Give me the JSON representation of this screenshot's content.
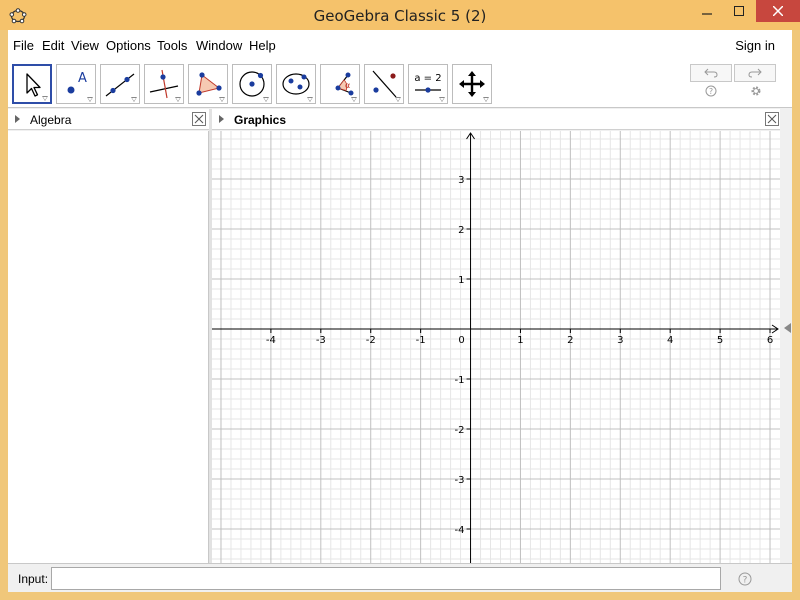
{
  "window": {
    "title": "GeoGebra Classic 5 (2)"
  },
  "menu": {
    "items": [
      "File",
      "Edit",
      "View",
      "Options",
      "Tools",
      "Window",
      "Help"
    ],
    "sign_in": "Sign in"
  },
  "toolbar": {
    "tools": [
      {
        "name": "move-tool",
        "icon": "arrow-pointer-icon"
      },
      {
        "name": "point-tool",
        "icon": "point-A-icon"
      },
      {
        "name": "line-tool",
        "icon": "line-through-points-icon"
      },
      {
        "name": "perpendicular-line-tool",
        "icon": "perpendicular-line-icon"
      },
      {
        "name": "polygon-tool",
        "icon": "polygon-icon"
      },
      {
        "name": "circle-tool",
        "icon": "circle-center-point-icon"
      },
      {
        "name": "ellipse-tool",
        "icon": "ellipse-icon"
      },
      {
        "name": "angle-tool",
        "icon": "angle-icon"
      },
      {
        "name": "reflect-tool",
        "icon": "reflect-about-line-icon"
      },
      {
        "name": "slider-tool",
        "icon": "slider-icon",
        "label": "a = 2"
      },
      {
        "name": "move-graphics-tool",
        "icon": "move-graphics-view-icon"
      }
    ],
    "undo_icon": "undo-icon",
    "redo_icon": "redo-icon"
  },
  "panels": {
    "algebra_title": "Algebra",
    "graphics_title": "Graphics"
  },
  "graphics": {
    "x_range": [
      -5.18,
      6.2
    ],
    "y_range": [
      -4.68,
      3.96
    ],
    "x_ticks": [
      "-4",
      "-3",
      "-2",
      "-1",
      "0",
      "1",
      "2",
      "3",
      "4",
      "5",
      "6"
    ],
    "y_ticks": [
      "3",
      "2",
      "1",
      "-1",
      "-2",
      "-3",
      "-4"
    ],
    "grid": true,
    "colors": {
      "major_grid": "#c0c0c0",
      "minor_grid": "#e6e6e6",
      "axes": "#000000"
    }
  },
  "input_bar": {
    "label": "Input:",
    "value": "",
    "placeholder": ""
  },
  "colors": {
    "title_bar": "#f5c26b",
    "active_tool_border": "#2e4da8",
    "close_button": "#c7473e",
    "point": "#1a3c9e"
  }
}
